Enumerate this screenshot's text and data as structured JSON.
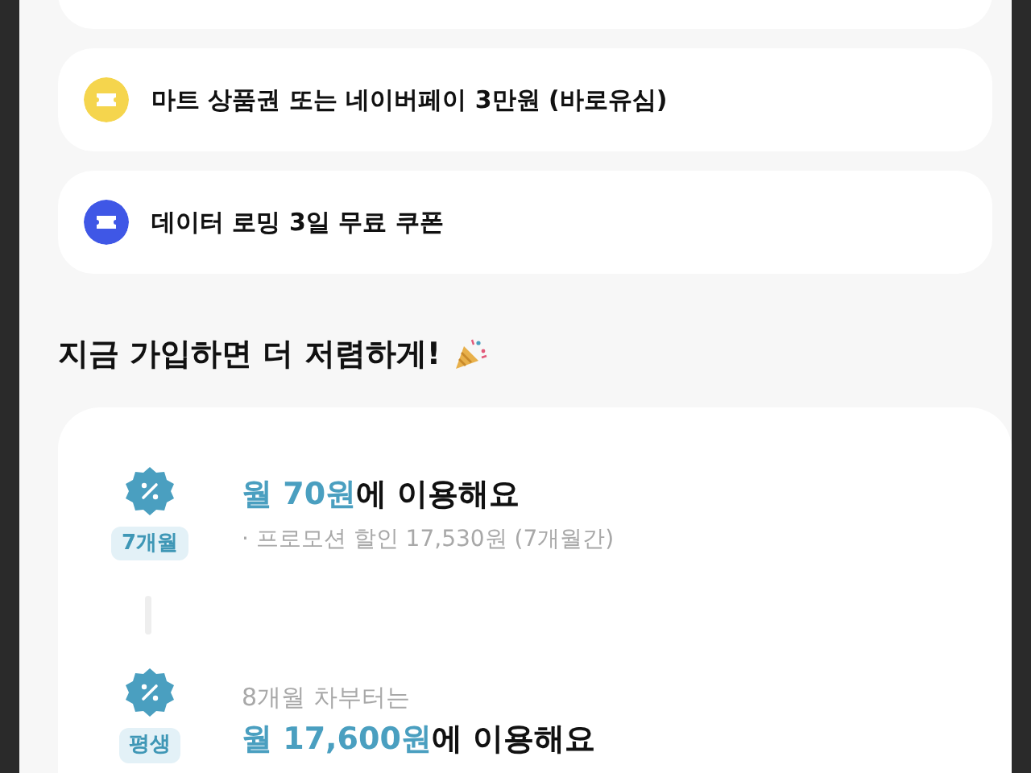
{
  "benefits": [
    {
      "kind": "cut"
    },
    {
      "kind": "voucher",
      "text": "마트 상품권 또는 네이버페이 3만원 (바로유심)"
    },
    {
      "kind": "roaming",
      "text": "데이터 로밍 3일 무료 쿠폰"
    }
  ],
  "promo_heading": "지금 가입하면 더 저렴하게!",
  "plan_steps": [
    {
      "tag": "7개월",
      "price": "월 70원",
      "suffix": "에 이용해요",
      "note": "· 프로모션 할인 17,530원 (7개월간)"
    },
    {
      "tag": "평생",
      "pre": "8개월 차부터는",
      "price": "월 17,600원",
      "suffix": "에 이용해요"
    }
  ]
}
